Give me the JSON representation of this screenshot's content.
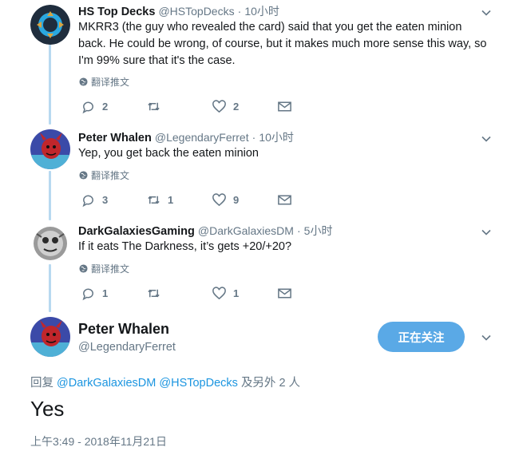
{
  "thread": [
    {
      "name": "HS Top Decks",
      "handle": "@HSTopDecks",
      "time": "10小时",
      "text": "MKRR3 (the guy who revealed the card) said that you get the eaten minion back. He could be wrong, of course, but it makes much more sense this way, so I'm 99% sure that it's the case.",
      "translate": "翻译推文",
      "replies": "2",
      "retweets": "",
      "likes": "2"
    },
    {
      "name": "Peter Whalen",
      "handle": "@LegendaryFerret",
      "time": "10小时",
      "text": "Yep, you get back the eaten minion",
      "translate": "翻译推文",
      "replies": "3",
      "retweets": "1",
      "likes": "9"
    },
    {
      "name": "DarkGalaxiesGaming",
      "handle": "@DarkGalaxiesDM",
      "time": "5小时",
      "text": "If it eats The Darkness, it’s gets +20/+20?",
      "translate": "翻译推文",
      "replies": "1",
      "retweets": "",
      "likes": "1"
    }
  ],
  "focus": {
    "name": "Peter Whalen",
    "handle": "@LegendaryFerret",
    "follow_label": "正在关注",
    "reply_prefix": "回复",
    "mention_1": "@DarkGalaxiesDM",
    "mention_2": "@HSTopDecks",
    "reply_suffix": "及另外 2 人",
    "text": "Yes",
    "timestamp": "上午3:49 - 2018年11月21日"
  },
  "dot": "·",
  "colors": {
    "accent": "#1b95e0",
    "follow_bg": "#5aa9e6",
    "muted": "#657786",
    "thread_line": "#b8d9f0"
  }
}
